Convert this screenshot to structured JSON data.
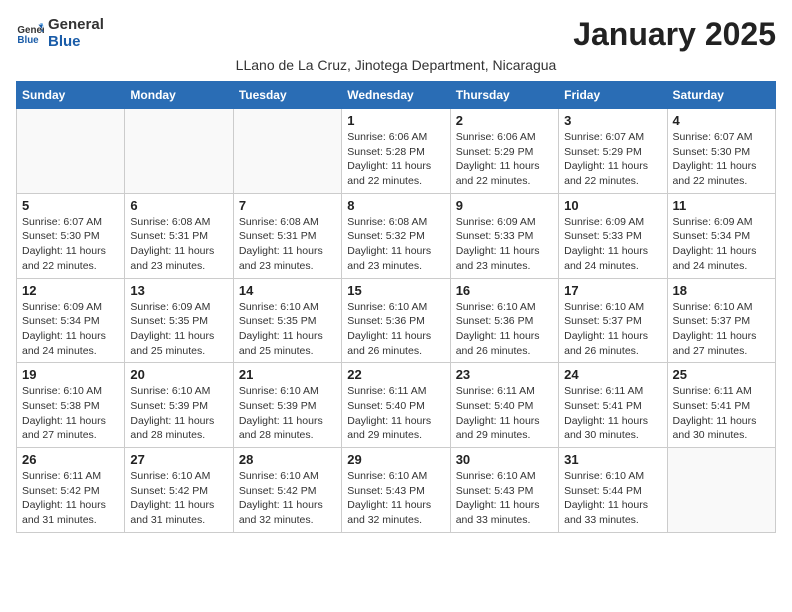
{
  "header": {
    "logo_line1": "General",
    "logo_line2": "Blue",
    "month_title": "January 2025",
    "subtitle": "LLano de La Cruz, Jinotega Department, Nicaragua"
  },
  "weekdays": [
    "Sunday",
    "Monday",
    "Tuesday",
    "Wednesday",
    "Thursday",
    "Friday",
    "Saturday"
  ],
  "weeks": [
    [
      {
        "day": "",
        "info": ""
      },
      {
        "day": "",
        "info": ""
      },
      {
        "day": "",
        "info": ""
      },
      {
        "day": "1",
        "info": "Sunrise: 6:06 AM\nSunset: 5:28 PM\nDaylight: 11 hours\nand 22 minutes."
      },
      {
        "day": "2",
        "info": "Sunrise: 6:06 AM\nSunset: 5:29 PM\nDaylight: 11 hours\nand 22 minutes."
      },
      {
        "day": "3",
        "info": "Sunrise: 6:07 AM\nSunset: 5:29 PM\nDaylight: 11 hours\nand 22 minutes."
      },
      {
        "day": "4",
        "info": "Sunrise: 6:07 AM\nSunset: 5:30 PM\nDaylight: 11 hours\nand 22 minutes."
      }
    ],
    [
      {
        "day": "5",
        "info": "Sunrise: 6:07 AM\nSunset: 5:30 PM\nDaylight: 11 hours\nand 22 minutes."
      },
      {
        "day": "6",
        "info": "Sunrise: 6:08 AM\nSunset: 5:31 PM\nDaylight: 11 hours\nand 23 minutes."
      },
      {
        "day": "7",
        "info": "Sunrise: 6:08 AM\nSunset: 5:31 PM\nDaylight: 11 hours\nand 23 minutes."
      },
      {
        "day": "8",
        "info": "Sunrise: 6:08 AM\nSunset: 5:32 PM\nDaylight: 11 hours\nand 23 minutes."
      },
      {
        "day": "9",
        "info": "Sunrise: 6:09 AM\nSunset: 5:33 PM\nDaylight: 11 hours\nand 23 minutes."
      },
      {
        "day": "10",
        "info": "Sunrise: 6:09 AM\nSunset: 5:33 PM\nDaylight: 11 hours\nand 24 minutes."
      },
      {
        "day": "11",
        "info": "Sunrise: 6:09 AM\nSunset: 5:34 PM\nDaylight: 11 hours\nand 24 minutes."
      }
    ],
    [
      {
        "day": "12",
        "info": "Sunrise: 6:09 AM\nSunset: 5:34 PM\nDaylight: 11 hours\nand 24 minutes."
      },
      {
        "day": "13",
        "info": "Sunrise: 6:09 AM\nSunset: 5:35 PM\nDaylight: 11 hours\nand 25 minutes."
      },
      {
        "day": "14",
        "info": "Sunrise: 6:10 AM\nSunset: 5:35 PM\nDaylight: 11 hours\nand 25 minutes."
      },
      {
        "day": "15",
        "info": "Sunrise: 6:10 AM\nSunset: 5:36 PM\nDaylight: 11 hours\nand 26 minutes."
      },
      {
        "day": "16",
        "info": "Sunrise: 6:10 AM\nSunset: 5:36 PM\nDaylight: 11 hours\nand 26 minutes."
      },
      {
        "day": "17",
        "info": "Sunrise: 6:10 AM\nSunset: 5:37 PM\nDaylight: 11 hours\nand 26 minutes."
      },
      {
        "day": "18",
        "info": "Sunrise: 6:10 AM\nSunset: 5:37 PM\nDaylight: 11 hours\nand 27 minutes."
      }
    ],
    [
      {
        "day": "19",
        "info": "Sunrise: 6:10 AM\nSunset: 5:38 PM\nDaylight: 11 hours\nand 27 minutes."
      },
      {
        "day": "20",
        "info": "Sunrise: 6:10 AM\nSunset: 5:39 PM\nDaylight: 11 hours\nand 28 minutes."
      },
      {
        "day": "21",
        "info": "Sunrise: 6:10 AM\nSunset: 5:39 PM\nDaylight: 11 hours\nand 28 minutes."
      },
      {
        "day": "22",
        "info": "Sunrise: 6:11 AM\nSunset: 5:40 PM\nDaylight: 11 hours\nand 29 minutes."
      },
      {
        "day": "23",
        "info": "Sunrise: 6:11 AM\nSunset: 5:40 PM\nDaylight: 11 hours\nand 29 minutes."
      },
      {
        "day": "24",
        "info": "Sunrise: 6:11 AM\nSunset: 5:41 PM\nDaylight: 11 hours\nand 30 minutes."
      },
      {
        "day": "25",
        "info": "Sunrise: 6:11 AM\nSunset: 5:41 PM\nDaylight: 11 hours\nand 30 minutes."
      }
    ],
    [
      {
        "day": "26",
        "info": "Sunrise: 6:11 AM\nSunset: 5:42 PM\nDaylight: 11 hours\nand 31 minutes."
      },
      {
        "day": "27",
        "info": "Sunrise: 6:10 AM\nSunset: 5:42 PM\nDaylight: 11 hours\nand 31 minutes."
      },
      {
        "day": "28",
        "info": "Sunrise: 6:10 AM\nSunset: 5:42 PM\nDaylight: 11 hours\nand 32 minutes."
      },
      {
        "day": "29",
        "info": "Sunrise: 6:10 AM\nSunset: 5:43 PM\nDaylight: 11 hours\nand 32 minutes."
      },
      {
        "day": "30",
        "info": "Sunrise: 6:10 AM\nSunset: 5:43 PM\nDaylight: 11 hours\nand 33 minutes."
      },
      {
        "day": "31",
        "info": "Sunrise: 6:10 AM\nSunset: 5:44 PM\nDaylight: 11 hours\nand 33 minutes."
      },
      {
        "day": "",
        "info": ""
      }
    ]
  ]
}
